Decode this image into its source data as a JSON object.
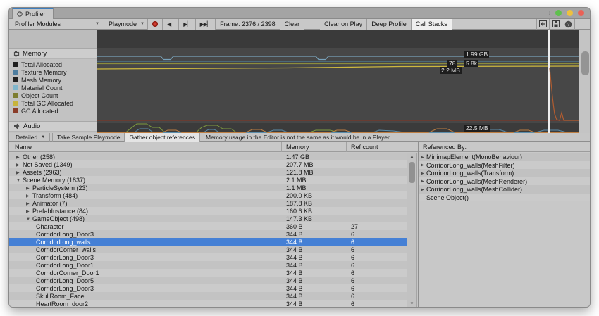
{
  "window": {
    "tab_title": "Profiler",
    "traffic_lights": {
      "green": "#5fc04d",
      "yellow": "#eec13d",
      "red": "#ea6156"
    }
  },
  "toolbar": {
    "modules_dropdown": "Profiler Modules",
    "playmode_dropdown": "Playmode",
    "frame_label": "Frame: 2376 / 2398",
    "clear_button": "Clear",
    "clear_on_play": "Clear on Play",
    "deep_profile": "Deep Profile",
    "call_stacks": "Call Stacks"
  },
  "modules": {
    "memory": {
      "title": "Memory",
      "legend": [
        {
          "label": "Total Allocated",
          "color": "#1e1e1e"
        },
        {
          "label": "Texture Memory",
          "color": "#4e7ea0"
        },
        {
          "label": "Mesh Memory",
          "color": "#202020"
        },
        {
          "label": "Material Count",
          "color": "#7fb6cc"
        },
        {
          "label": "Object Count",
          "color": "#7d7d30"
        },
        {
          "label": "Total GC Allocated",
          "color": "#c8b43c"
        },
        {
          "label": "GC Allocated",
          "color": "#8a3c28"
        }
      ]
    },
    "audio": {
      "title": "Audio"
    }
  },
  "chart": {
    "labels": {
      "total_allocated": "1.99 GB",
      "material_count": "78",
      "object_count": "5.8k",
      "gc_allocated": "2.2 MB",
      "audio_value": "22.5 MB"
    },
    "accent_frame_line": "#ededed"
  },
  "detail_toolbar": {
    "detailed_dropdown": "Detailed",
    "take_sample": "Take Sample Playmode",
    "gather_refs": "Gather object references",
    "editor_note": "Memory usage in the Editor is not the same as it would be in a Player."
  },
  "table": {
    "columns": {
      "name": "Name",
      "memory": "Memory",
      "ref_count": "Ref count"
    },
    "rows": [
      {
        "name": "Other (258)",
        "memory": "1.47 GB",
        "ref": "",
        "level": 0,
        "arrow": "collapsed"
      },
      {
        "name": "Not Saved (1349)",
        "memory": "207.7 MB",
        "ref": "",
        "level": 0,
        "arrow": "collapsed"
      },
      {
        "name": "Assets (2963)",
        "memory": "121.8 MB",
        "ref": "",
        "level": 0,
        "arrow": "collapsed"
      },
      {
        "name": "Scene Memory (1837)",
        "memory": "2.1 MB",
        "ref": "",
        "level": 0,
        "arrow": "expanded"
      },
      {
        "name": "ParticleSystem (23)",
        "memory": "1.1 MB",
        "ref": "",
        "level": 1,
        "arrow": "collapsed"
      },
      {
        "name": "Transform (484)",
        "memory": "200.0 KB",
        "ref": "",
        "level": 1,
        "arrow": "collapsed"
      },
      {
        "name": "Animator (7)",
        "memory": "187.8 KB",
        "ref": "",
        "level": 1,
        "arrow": "collapsed"
      },
      {
        "name": "PrefabInstance (84)",
        "memory": "160.6 KB",
        "ref": "",
        "level": 1,
        "arrow": "collapsed"
      },
      {
        "name": "GameObject (498)",
        "memory": "147.3 KB",
        "ref": "",
        "level": 1,
        "arrow": "expanded"
      },
      {
        "name": "Character",
        "memory": "360 B",
        "ref": "27",
        "level": 2,
        "arrow": "none"
      },
      {
        "name": "CorridorLong_Door3",
        "memory": "344 B",
        "ref": "6",
        "level": 2,
        "arrow": "none"
      },
      {
        "name": "CorridorLong_walls",
        "memory": "344 B",
        "ref": "6",
        "level": 2,
        "arrow": "none",
        "selected": true
      },
      {
        "name": "CorridorCorner_walls",
        "memory": "344 B",
        "ref": "6",
        "level": 2,
        "arrow": "none"
      },
      {
        "name": "CorridorLong_Door3",
        "memory": "344 B",
        "ref": "6",
        "level": 2,
        "arrow": "none"
      },
      {
        "name": "CorridorLong_Door1",
        "memory": "344 B",
        "ref": "6",
        "level": 2,
        "arrow": "none"
      },
      {
        "name": "CorridorCorner_Door1",
        "memory": "344 B",
        "ref": "6",
        "level": 2,
        "arrow": "none"
      },
      {
        "name": "CorridorLong_Door5",
        "memory": "344 B",
        "ref": "6",
        "level": 2,
        "arrow": "none"
      },
      {
        "name": "CorridorLong_Door3",
        "memory": "344 B",
        "ref": "6",
        "level": 2,
        "arrow": "none"
      },
      {
        "name": "SkullRoom_Face",
        "memory": "344 B",
        "ref": "6",
        "level": 2,
        "arrow": "none"
      },
      {
        "name": "HeartRoom_door2",
        "memory": "344 B",
        "ref": "6",
        "level": 2,
        "arrow": "none"
      }
    ]
  },
  "referenced_by": {
    "title": "Referenced By:",
    "items": [
      {
        "label": "MinimapElement(MonoBehaviour)",
        "arrow": true
      },
      {
        "label": "CorridorLong_walls(MeshFilter)",
        "arrow": true
      },
      {
        "label": "CorridorLong_walls(Transform)",
        "arrow": true
      },
      {
        "label": "CorridorLong_walls(MeshRenderer)",
        "arrow": true
      },
      {
        "label": "CorridorLong_walls(MeshCollider)",
        "arrow": true
      },
      {
        "label": "Scene Object()",
        "arrow": false
      }
    ]
  }
}
